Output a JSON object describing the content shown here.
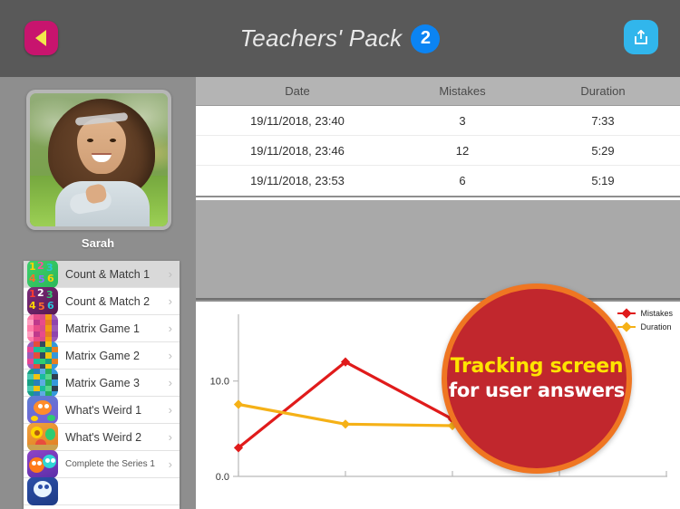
{
  "header": {
    "title": "Teachers' Pack",
    "badge": "2",
    "back_icon": "back-triangle-icon",
    "share_icon": "share-upload-icon"
  },
  "sidebar": {
    "profile": {
      "name": "Sarah",
      "photo_alt": "girl-lying-on-grass-photo"
    },
    "games": [
      {
        "label": "Count & Match 1",
        "selected": true,
        "icon": "numbers-green-icon"
      },
      {
        "label": "Count & Match 2",
        "selected": false,
        "icon": "numbers-purple-icon"
      },
      {
        "label": "Matrix Game 1",
        "selected": false,
        "icon": "matrix-pink-grid-icon"
      },
      {
        "label": "Matrix Game 2",
        "selected": false,
        "icon": "matrix-rainbow-grid-icon"
      },
      {
        "label": "Matrix Game 3",
        "selected": false,
        "icon": "matrix-blue-grid-icon"
      },
      {
        "label": "What's Weird 1",
        "selected": false,
        "icon": "orange-fish-icon"
      },
      {
        "label": "What's Weird 2",
        "selected": false,
        "icon": "lion-ball-icon"
      },
      {
        "label": "Complete the Series 1",
        "selected": false,
        "icon": "two-monsters-icon"
      },
      {
        "label": "",
        "selected": false,
        "icon": "partial-icon"
      }
    ],
    "chevron": "›"
  },
  "table": {
    "columns": [
      "Date",
      "Mistakes",
      "Duration"
    ],
    "rows": [
      {
        "date": "19/11/2018, 23:40",
        "mistakes": "3",
        "duration": "7:33"
      },
      {
        "date": "19/11/2018, 23:46",
        "mistakes": "12",
        "duration": "5:29"
      },
      {
        "date": "19/11/2018, 23:53",
        "mistakes": "6",
        "duration": "5:19"
      }
    ]
  },
  "callout": {
    "line1": "Tracking screen",
    "line2": "for user answers",
    "circle_color": "#c1272d",
    "ring_color": "#ef7622",
    "line1_color": "#ffe400",
    "line2_color": "#ffffff"
  },
  "chart_data": {
    "type": "line",
    "title": "",
    "xlabel": "",
    "ylabel": "",
    "x": [
      1,
      2,
      3
    ],
    "categories": [
      "19/11/2018, 23:40",
      "19/11/2018, 23:46",
      "19/11/2018, 23:53"
    ],
    "series": [
      {
        "name": "Mistakes",
        "values": [
          3,
          12,
          6
        ],
        "color": "#e01b1b"
      },
      {
        "name": "Duration",
        "values": [
          7.55,
          5.48,
          5.32
        ],
        "color": "#f5b117"
      }
    ],
    "ytick_labels": [
      "0.0",
      "10.0"
    ],
    "yticks": [
      0,
      10
    ],
    "ylim": [
      0,
      17
    ],
    "xticks": [
      0,
      1,
      2,
      3,
      4
    ],
    "grid": false,
    "legend_position": "top-right"
  }
}
